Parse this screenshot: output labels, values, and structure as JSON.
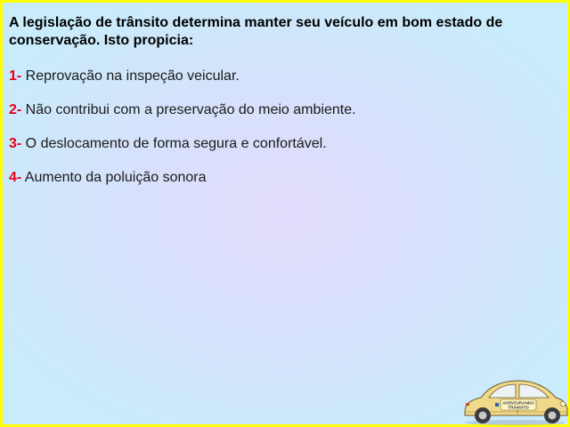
{
  "question": {
    "line1": "A legislação de trânsito determina manter seu veículo em bom estado de",
    "line2": "conservação. Isto propicia:"
  },
  "options": [
    {
      "num": "1-",
      "text": " Reprovação na inspeção veicular."
    },
    {
      "num": "2-",
      "text": " Não contribui com a preservação do meio ambiente."
    },
    {
      "num": "3-",
      "text": " O deslocamento de forma segura e confortável."
    },
    {
      "num": "4-",
      "text": " Aumento da poluição sonora"
    }
  ],
  "logo": {
    "line1": "AVENTURANDO",
    "line2": "TRÂNSITO"
  },
  "colors": {
    "border": "#ffff00",
    "option_number": "#e8001c",
    "car_body": "#f0d98a"
  }
}
